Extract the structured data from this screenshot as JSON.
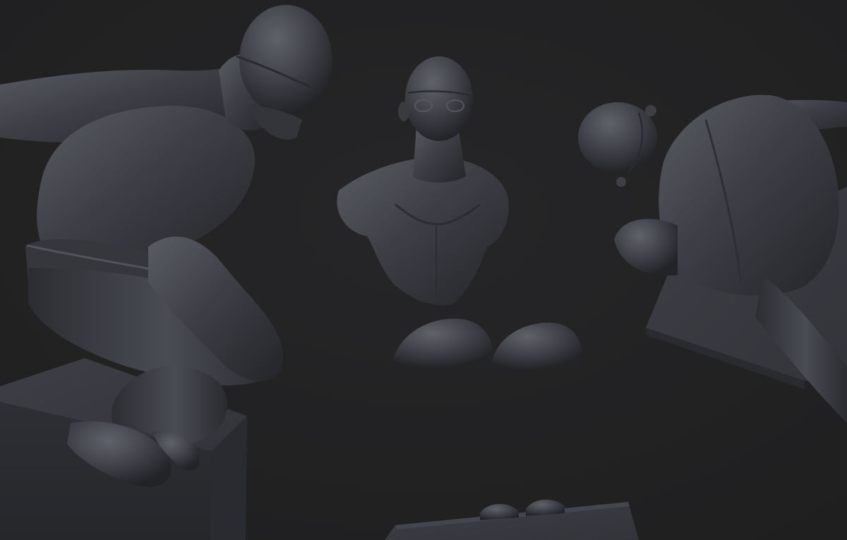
{
  "scene": {
    "background_color": "#232324",
    "clay_color": "#3b3c42",
    "clay_highlight": "#5c5e67",
    "clay_shadow": "#1d1d21",
    "subjects": [
      {
        "name": "crouching-swimmer-figure",
        "view": "side"
      },
      {
        "name": "swimmer-bust",
        "view": "front"
      },
      {
        "name": "swimmer-knees-fragment",
        "view": "front"
      },
      {
        "name": "crouching-swimmer-figure",
        "view": "top-back"
      },
      {
        "name": "starting-block-with-hands",
        "view": "front"
      }
    ]
  }
}
